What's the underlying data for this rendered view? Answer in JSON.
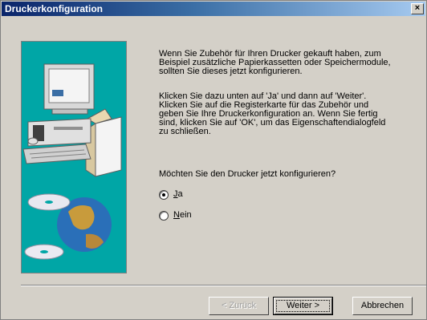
{
  "window": {
    "title": "Druckerkonfiguration",
    "close_glyph": "×"
  },
  "content": {
    "paragraph1": "Wenn Sie Zubehör für Ihren Drucker gekauft haben, zum\nBeispiel zusätzliche Papierkassetten oder Speichermodule,\nsollten Sie dieses jetzt konfigurieren.",
    "paragraph2": "Klicken Sie dazu unten auf 'Ja' und dann auf 'Weiter'.\nKlicken Sie auf die Registerkarte für das Zubehör und\ngeben Sie Ihre Druckerkonfiguration an. Wenn Sie fertig\nsind, klicken Sie auf 'OK', um das Eigenschaftendialogfeld\nzu schließen.",
    "question": "Möchten Sie den Drucker jetzt konfigurieren?"
  },
  "options": [
    {
      "label_accel": "J",
      "label_rest": "a",
      "selected": true
    },
    {
      "label_accel": "N",
      "label_rest": "ein",
      "selected": false
    }
  ],
  "buttons": {
    "back": "< Zurück",
    "next": "Weiter >",
    "cancel": "Abbrechen"
  },
  "colors": {
    "titlebar_start": "#0a246a",
    "illustration_bg": "#00a6a6",
    "dialog_bg": "#d4d0c8"
  }
}
